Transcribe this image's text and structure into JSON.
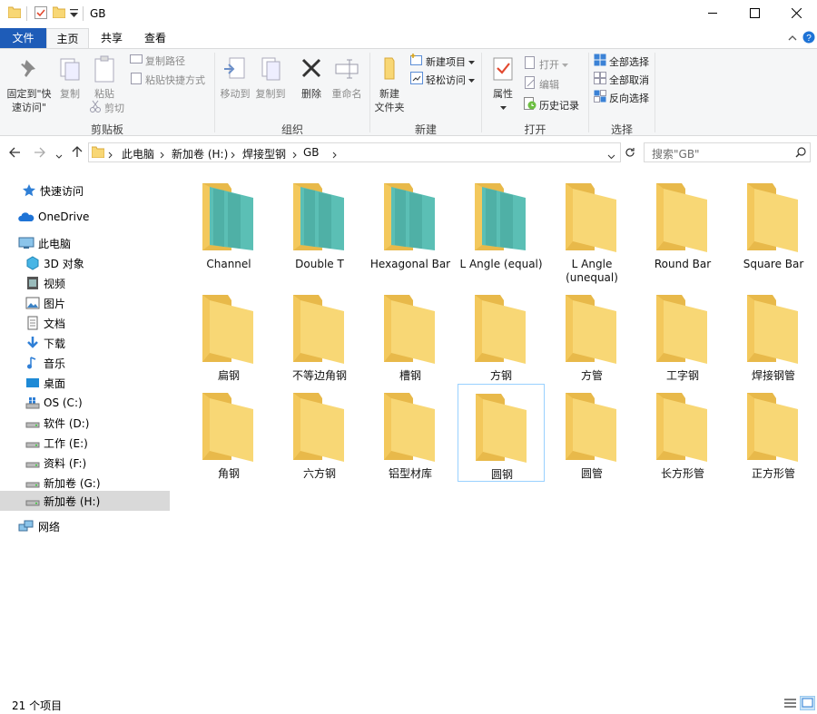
{
  "window": {
    "title": "GB"
  },
  "tabs": [
    "文件",
    "主页",
    "共享",
    "查看"
  ],
  "ribbon": {
    "clipboard": {
      "pin_label": "固定到\"快\n速访问\"",
      "copy_label": "复制",
      "paste_label": "粘贴",
      "copy_path_label": "复制路径",
      "paste_shortcut_label": "粘贴快捷方式",
      "cut_label": "剪切",
      "group_label": "剪贴板"
    },
    "organize": {
      "move_to_label": "移动到",
      "copy_to_label": "复制到",
      "delete_label": "删除",
      "rename_label": "重命名",
      "group_label": "组织"
    },
    "new": {
      "new_folder_label": "新建\n文件夹",
      "new_item_label": "新建项目",
      "easy_access_label": "轻松访问",
      "group_label": "新建"
    },
    "open": {
      "properties_label": "属性",
      "open_label": "打开",
      "edit_label": "编辑",
      "history_label": "历史记录",
      "group_label": "打开"
    },
    "select": {
      "select_all_label": "全部选择",
      "select_none_label": "全部取消",
      "invert_label": "反向选择",
      "group_label": "选择"
    }
  },
  "address": {
    "crumbs": [
      "此电脑",
      "新加卷 (H:)",
      "焊接型钢",
      "GB"
    ],
    "search_placeholder": "搜索\"GB\""
  },
  "navpane": {
    "quick_access": "快速访问",
    "onedrive": "OneDrive",
    "this_pc": "此电脑",
    "items": [
      "3D 对象",
      "视频",
      "图片",
      "文档",
      "下载",
      "音乐",
      "桌面",
      "OS (C:)",
      "软件 (D:)",
      "工作 (E:)",
      "资料 (F:)",
      "新加卷 (G:)",
      "新加卷 (H:)"
    ],
    "network": "网络"
  },
  "folders": [
    {
      "name": "Channel",
      "teal": true
    },
    {
      "name": "Double T",
      "teal": true
    },
    {
      "name": "Hexagonal Bar",
      "teal": true
    },
    {
      "name": "L Angle (equal)",
      "teal": true
    },
    {
      "name": "L Angle (unequal)",
      "teal": false
    },
    {
      "name": "Round Bar",
      "teal": false
    },
    {
      "name": "Square Bar",
      "teal": false
    },
    {
      "name": "扁钢",
      "teal": false
    },
    {
      "name": "不等边角钢",
      "teal": false
    },
    {
      "name": "槽钢",
      "teal": false
    },
    {
      "name": "方钢",
      "teal": false
    },
    {
      "name": "方管",
      "teal": false
    },
    {
      "name": "工字钢",
      "teal": false
    },
    {
      "name": "焊接钢管",
      "teal": false
    },
    {
      "name": "角钢",
      "teal": false
    },
    {
      "name": "六方钢",
      "teal": false
    },
    {
      "name": "铝型材库",
      "teal": false
    },
    {
      "name": "圆钢",
      "teal": false,
      "selected": true
    },
    {
      "name": "圆管",
      "teal": false
    },
    {
      "name": "长方形管",
      "teal": false
    },
    {
      "name": "正方形管",
      "teal": false
    }
  ],
  "status": {
    "count_text": "21 个项目"
  },
  "colors": {
    "accent": "#1e5cb8",
    "folder": "#f8d775",
    "folder_dark": "#e8b94a",
    "teal": "#5bbfb5",
    "selection": "#d9d9d9"
  }
}
